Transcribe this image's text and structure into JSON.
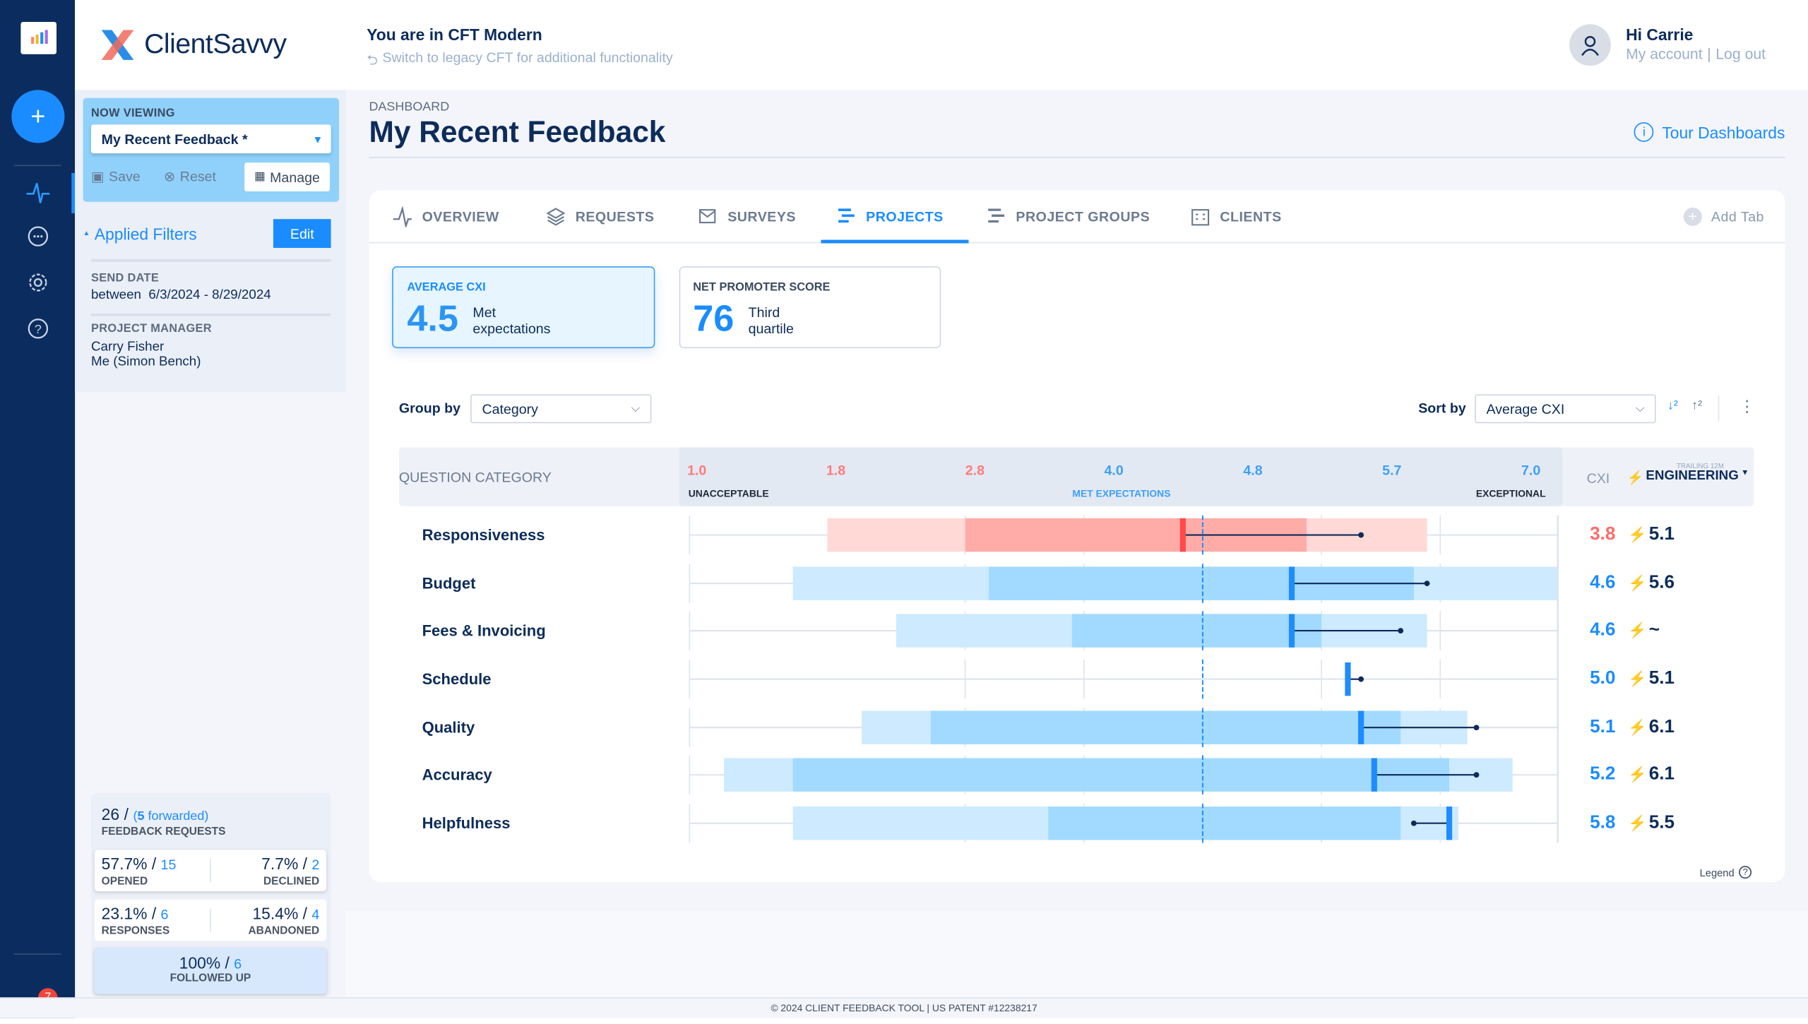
{
  "app": {
    "brand": "ClientSavvy",
    "mode_title": "You are in CFT Modern",
    "legacy_link": "Switch to legacy CFT for additional functionality"
  },
  "user": {
    "greeting": "Hi Carrie",
    "my_account": "My account",
    "separator": "|",
    "log_out": "Log out"
  },
  "rail": {
    "notifications_count": "7"
  },
  "left_panel": {
    "now_viewing_label": "NOW VIEWING",
    "view_selected": "My Recent Feedback *",
    "save": "Save",
    "reset": "Reset",
    "manage": "Manage",
    "applied_filters": "Applied Filters",
    "edit": "Edit",
    "filters": [
      {
        "label": "SEND DATE",
        "values": [
          "between  6/3/2024 - 8/29/2024"
        ]
      },
      {
        "label": "PROJECT MANAGER",
        "values": [
          "Carry Fisher",
          "Me (Simon Bench)"
        ]
      }
    ],
    "stats": {
      "requests_total": "26",
      "forwarded_count": "5",
      "forwarded_word": "forwarded",
      "requests_label": "FEEDBACK REQUESTS",
      "opened_pct": "57.7%",
      "opened_n": "15",
      "opened_label": "OPENED",
      "declined_pct": "7.7%",
      "declined_n": "2",
      "declined_label": "DECLINED",
      "responses_pct": "23.1%",
      "responses_n": "6",
      "responses_label": "RESPONSES",
      "abandoned_pct": "15.4%",
      "abandoned_n": "4",
      "abandoned_label": "ABANDONED",
      "followed_pct": "100%",
      "followed_n": "6",
      "followed_label": "FOLLOWED UP"
    }
  },
  "page": {
    "breadcrumb": "DASHBOARD",
    "title": "My Recent Feedback",
    "tour": "Tour Dashboards"
  },
  "tabs": [
    {
      "label": "OVERVIEW",
      "icon": "pulse-icon"
    },
    {
      "label": "REQUESTS",
      "icon": "layers-icon"
    },
    {
      "label": "SURVEYS",
      "icon": "survey-icon"
    },
    {
      "label": "PROJECTS",
      "icon": "projects-icon",
      "active": true
    },
    {
      "label": "PROJECT GROUPS",
      "icon": "project-groups-icon"
    },
    {
      "label": "CLIENTS",
      "icon": "building-icon"
    }
  ],
  "add_tab": "Add Tab",
  "kpis": [
    {
      "label": "AVERAGE CXI",
      "value": "4.5",
      "desc1": "Met",
      "desc2": "expectations"
    },
    {
      "label": "NET PROMOTER SCORE",
      "value": "76",
      "desc1": "Third",
      "desc2": "quartile"
    }
  ],
  "controls": {
    "group_by_label": "Group by",
    "group_by_value": "Category",
    "sort_by_label": "Sort by",
    "sort_by_value": "Average CXI"
  },
  "table": {
    "category_header": "QUESTION CATEGORY",
    "cxi_header": "CXI",
    "compare_header": "ENGINEERING",
    "compare_sub": "TRAILING 12M",
    "legend": "Legend"
  },
  "colors": {
    "accent": "#1a8cff",
    "negative": "#ff6b6b",
    "navy": "#0d2c5a",
    "bolt": "#f9b820"
  },
  "chart_data": {
    "type": "range-bar",
    "axis": {
      "ticks": [
        1.0,
        1.8,
        2.8,
        4.0,
        4.8,
        5.7,
        7.0
      ],
      "tick_labels": [
        "1.0",
        "1.8",
        "2.8",
        "4.0",
        "4.8",
        "5.7",
        "7.0"
      ],
      "range": [
        1.0,
        7.0
      ],
      "bands": [
        "UNACCEPTABLE",
        "MET EXPECTATIONS",
        "EXCEPTIONAL"
      ],
      "reference": 4.0,
      "grid": true
    },
    "rows": [
      {
        "category": "Responsiveness",
        "cxi": 3.8,
        "cxi_label": "3.8",
        "compare": 5.1,
        "compare_label": "5.1",
        "outer": [
          1.4,
          5.6
        ],
        "inner": [
          1.8,
          4.7
        ],
        "negative": true
      },
      {
        "category": "Budget",
        "cxi": 4.6,
        "cxi_label": "4.6",
        "compare": 5.6,
        "compare_label": "5.6",
        "outer": [
          1.3,
          7.0
        ],
        "inner": [
          2.0,
          5.5
        ]
      },
      {
        "category": "Fees & Invoicing",
        "cxi": 4.6,
        "cxi_label": "4.6",
        "compare": 5.4,
        "compare_label": "~",
        "outer": [
          1.6,
          5.6
        ],
        "inner": [
          2.7,
          4.8
        ]
      },
      {
        "category": "Schedule",
        "cxi": 5.0,
        "cxi_label": "5.0",
        "compare": 5.1,
        "compare_label": "5.1",
        "outer": null,
        "inner": null
      },
      {
        "category": "Quality",
        "cxi": 5.1,
        "cxi_label": "5.1",
        "compare": 6.1,
        "compare_label": "6.1",
        "outer": [
          1.5,
          6.0
        ],
        "inner": [
          1.7,
          5.4
        ]
      },
      {
        "category": "Accuracy",
        "cxi": 5.2,
        "cxi_label": "5.2",
        "compare": 6.1,
        "compare_label": "6.1",
        "outer": [
          1.1,
          6.5
        ],
        "inner": [
          1.3,
          5.8
        ]
      },
      {
        "category": "Helpfulness",
        "cxi": 5.8,
        "cxi_label": "5.8",
        "compare": 5.5,
        "compare_label": "5.5",
        "outer": [
          1.3,
          5.9
        ],
        "inner": [
          2.5,
          5.4
        ]
      }
    ]
  },
  "footer": "© 2024 CLIENT FEEDBACK TOOL | US PATENT #12238217"
}
